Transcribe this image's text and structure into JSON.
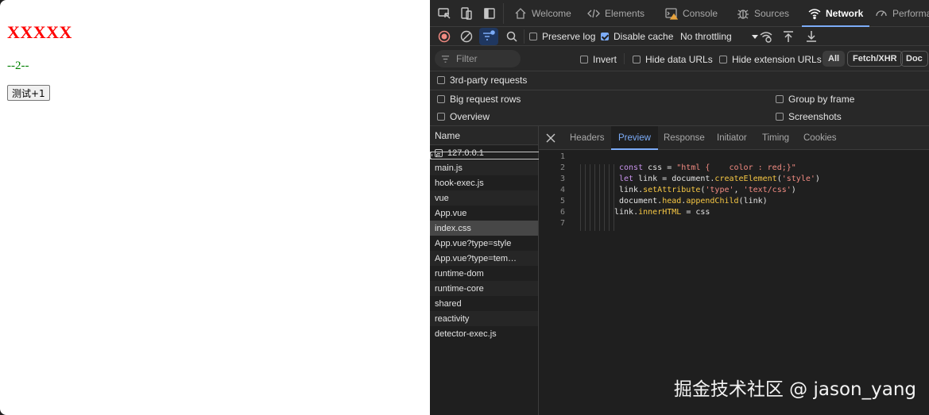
{
  "page": {
    "title": "XXXXX",
    "counter": "--2--",
    "button": "测试+1"
  },
  "devtools": {
    "tabs": [
      {
        "label": "Welcome",
        "icon": "house-icon"
      },
      {
        "label": "Elements",
        "icon": "code-brackets-icon"
      },
      {
        "label": "Console",
        "icon": "terminal-warning-icon"
      },
      {
        "label": "Sources",
        "icon": "bug-icon"
      },
      {
        "label": "Network",
        "icon": "wifi-icon"
      },
      {
        "label": "Performa",
        "icon": "gauge-icon"
      }
    ],
    "toolbar": {
      "preserve_log": "Preserve log",
      "disable_cache": "Disable cache",
      "throttling": "No throttling"
    },
    "filter": {
      "placeholder": "Filter",
      "invert": "Invert",
      "hide_data_urls": "Hide data URLs",
      "hide_extension_urls": "Hide extension URLs",
      "pills": [
        "All",
        "Fetch/XHR",
        "Doc"
      ]
    },
    "options": {
      "third_party": "3rd-party requests",
      "big_rows": "Big request rows",
      "group_by_frame": "Group by frame",
      "overview": "Overview",
      "screenshots": "Screenshots"
    },
    "requests": {
      "header": "Name",
      "items": [
        "127.0.0.1",
        "main.js",
        "hook-exec.js",
        "vue",
        "App.vue",
        "index.css",
        "App.vue?type=style",
        "App.vue?type=tem…",
        "runtime-dom",
        "runtime-core",
        "shared",
        "reactivity",
        "detector-exec.js"
      ]
    },
    "detail_tabs": [
      "Headers",
      "Preview",
      "Response",
      "Initiator",
      "Timing",
      "Cookies"
    ],
    "code_lines": [
      "1",
      "2",
      "3",
      "4",
      "5",
      "6",
      "7"
    ],
    "code": {
      "l2_kw": "const",
      "l2_a": " css = ",
      "l2_str": "\"html {    color : red;}\"",
      "l3_kw": "let",
      "l3_a": " link = document.",
      "l3_fn": "createElement",
      "l3_b": "(",
      "l3_str": "'style'",
      "l3_c": ")",
      "l4_a": "link.",
      "l4_fn": "setAttribute",
      "l4_b": "(",
      "l4_str1": "'type'",
      "l4_c": ", ",
      "l4_str2": "'text/css'",
      "l4_d": ")",
      "l5_a": "document.",
      "l5_fn1": "head",
      "l5_b": ".",
      "l5_fn2": "appendChild",
      "l5_c": "(link)",
      "l6_a": "link.",
      "l6_fn": "innerHTML",
      "l6_b": " = css"
    }
  },
  "watermark": "掘金技术社区 @ jason_yang"
}
